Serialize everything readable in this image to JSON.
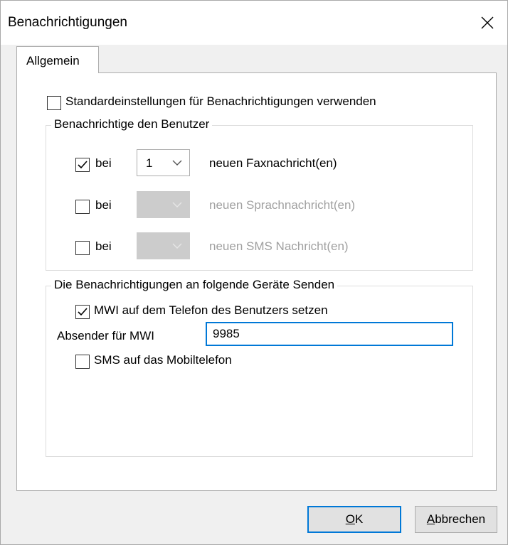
{
  "window": {
    "title": "Benachrichtigungen"
  },
  "tabs": [
    {
      "label": "Allgemein",
      "active": true
    }
  ],
  "standard_settings": {
    "label": "Standardeinstellungen für Benachrichtigungen verwenden",
    "checked": false
  },
  "notify_group": {
    "legend": "Benachrichtige den Benutzer",
    "rows": [
      {
        "checkbox_label": "bei",
        "checked": true,
        "count": "1",
        "enabled": true,
        "text": "neuen Faxnachricht(en)"
      },
      {
        "checkbox_label": "bei",
        "checked": false,
        "count": "",
        "enabled": false,
        "text": "neuen Sprachnachricht(en)"
      },
      {
        "checkbox_label": "bei",
        "checked": false,
        "count": "",
        "enabled": false,
        "text": "neuen SMS Nachricht(en)"
      }
    ]
  },
  "devices_group": {
    "legend": "Die Benachrichtigungen an folgende Geräte Senden",
    "mwi": {
      "label": "MWI auf dem Telefon des Benutzers setzen",
      "checked": true
    },
    "sender": {
      "label": "Absender für MWI",
      "value": "9985"
    },
    "sms": {
      "label": "SMS auf das Mobiltelefon",
      "checked": false
    }
  },
  "buttons": {
    "ok": "OK",
    "cancel": "Abbrechen"
  },
  "colors": {
    "accent": "#0078d7",
    "disabled_text": "#a0a0a0"
  }
}
